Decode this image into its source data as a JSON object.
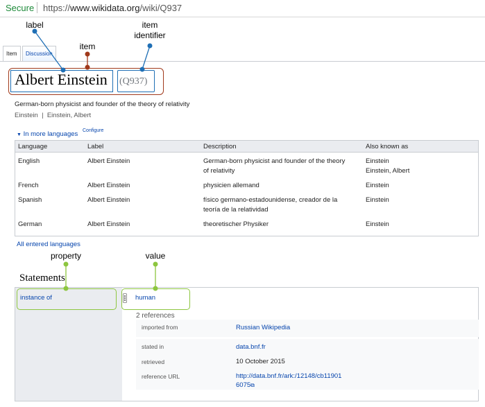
{
  "browser": {
    "secure_label": "Secure",
    "url_scheme": "https://",
    "url_host": "www.wikidata.org",
    "url_path": "/wiki/Q937"
  },
  "tabs": {
    "item": "Item",
    "discussion": "Discussion"
  },
  "entity": {
    "label": "Albert Einstein",
    "id": "(Q937)",
    "description": "German-born physicist and founder of the theory of relativity",
    "aliases": "Einstein  |  Einstein, Albert"
  },
  "languages": {
    "toggle": "In more languages",
    "configure": "Configure",
    "headers": [
      "Language",
      "Label",
      "Description",
      "Also known as"
    ],
    "rows": [
      {
        "language": "English",
        "label": "Albert Einstein",
        "description": [
          "German-born physicist and founder of the theory",
          "of relativity"
        ],
        "aka": [
          "Einstein",
          "Einstein, Albert"
        ]
      },
      {
        "language": "French",
        "label": "Albert Einstein",
        "description": [
          "physicien allemand"
        ],
        "aka": [
          "Einstein"
        ]
      },
      {
        "language": "Spanish",
        "label": "Albert Einstein",
        "description": [
          "físico germano-estadounidense, creador de la",
          "teoría de la relatividad"
        ],
        "aka": [
          "Einstein"
        ]
      },
      {
        "language": "German",
        "label": "Albert Einstein",
        "description": [
          "theoretischer Physiker"
        ],
        "aka": [
          "Einstein"
        ]
      }
    ],
    "all_link": "All entered languages"
  },
  "statements": {
    "heading": "Statements",
    "property": "instance of",
    "value": "human",
    "references_count": "2 references",
    "ref1": {
      "key": "imported from",
      "value": "Russian Wikipedia"
    },
    "ref2": [
      {
        "key": "stated in",
        "value": "data.bnf.fr"
      },
      {
        "key": "retrieved",
        "value": "10 October 2015"
      },
      {
        "key": "reference URL",
        "value_line1": "http://data.bnf.fr/ark:/12148/cb11901",
        "value_line2": "6075"
      }
    ]
  },
  "annotations": {
    "label": "label",
    "item": "item",
    "item_identifier_line1": "item",
    "item_identifier_line2": "identifier",
    "property": "property",
    "value": "value"
  },
  "colors": {
    "annotation_blue": "#1f6fb5",
    "annotation_brown": "#a0391b",
    "annotation_green": "#8dc63f",
    "link_blue": "#0645ad",
    "secure_green": "#1e8a3a"
  },
  "icons": {
    "rank": "normal-rank-icon",
    "external": "external-link-icon"
  }
}
